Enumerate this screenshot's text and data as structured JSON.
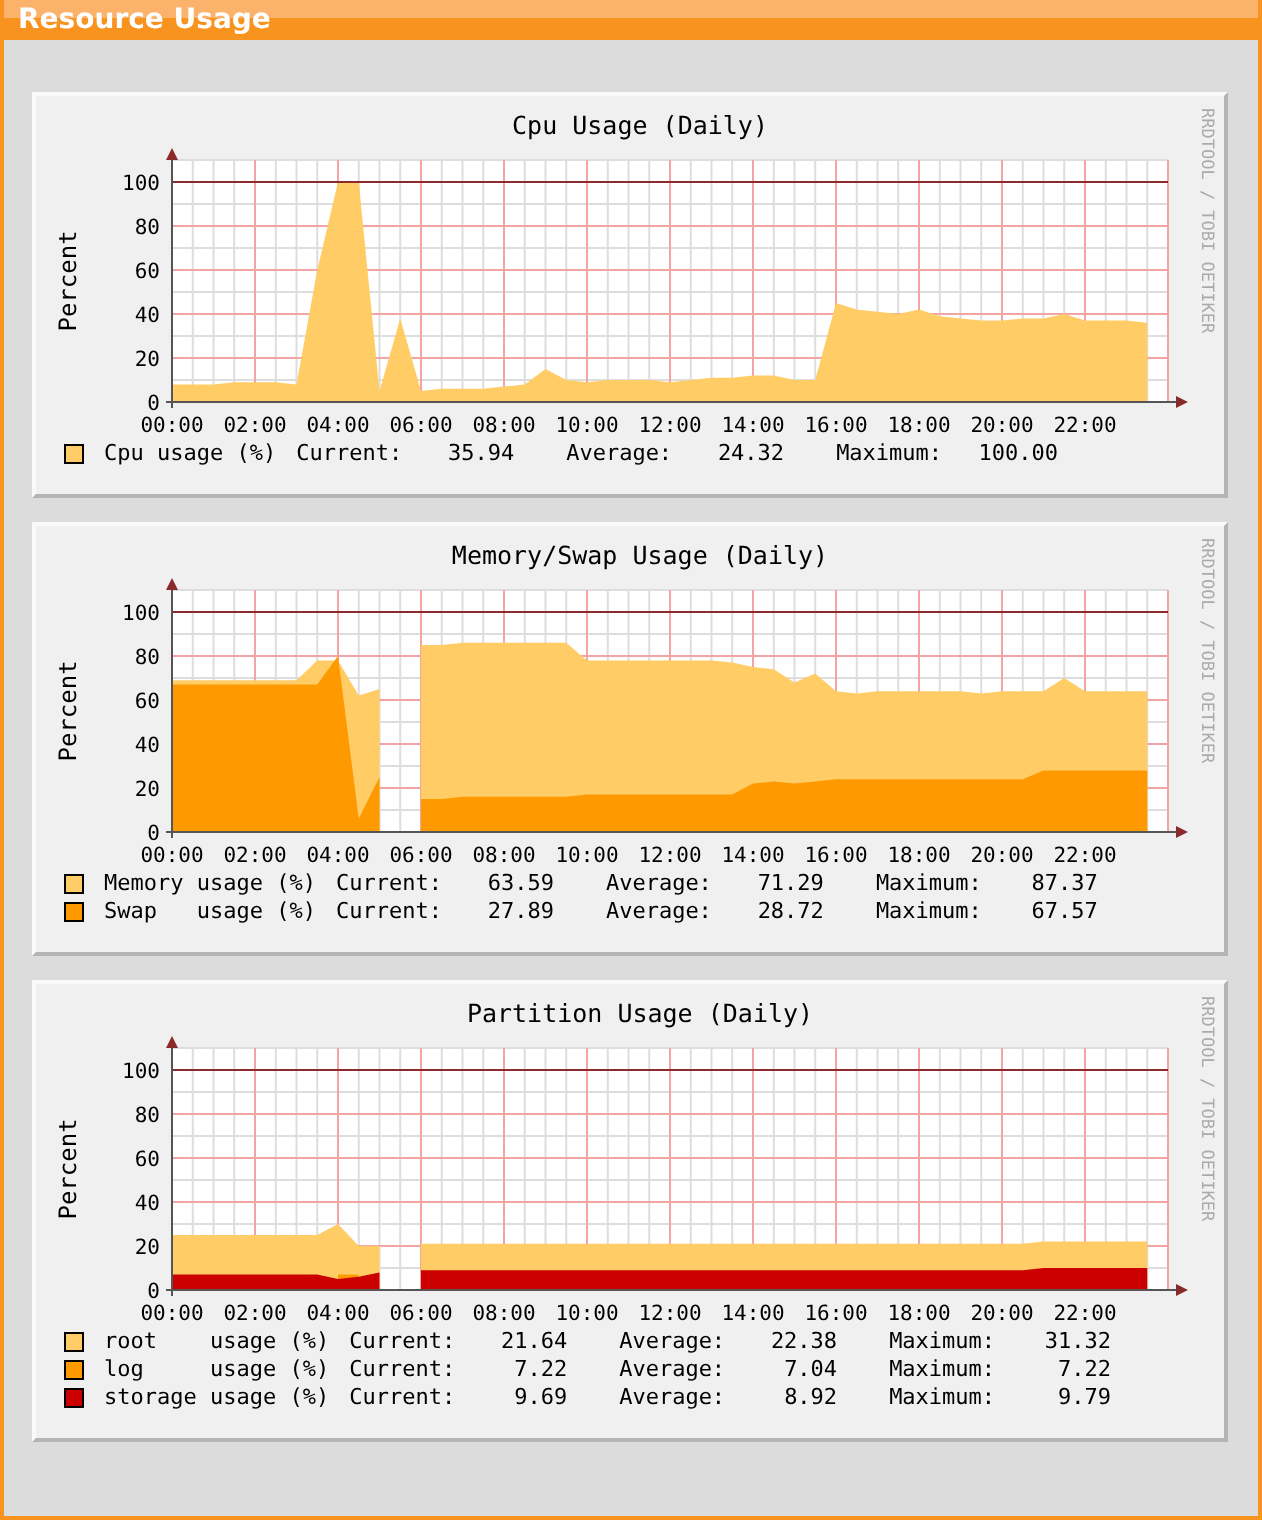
{
  "header": {
    "title": "Resource Usage"
  },
  "graphs": [
    {
      "credit": "RRDTOOL / TOBI OETIKER",
      "chart_data": {
        "type": "area",
        "title": "Cpu Usage (Daily)",
        "ylabel": "Percent",
        "grid": true,
        "x": [
          0,
          0.5,
          1,
          1.5,
          2,
          2.5,
          3,
          3.5,
          4,
          4.5,
          5,
          5.5,
          6,
          6.5,
          7,
          7.5,
          8,
          8.5,
          9,
          9.5,
          10,
          10.5,
          11,
          11.5,
          12,
          12.5,
          13,
          13.5,
          14,
          14.5,
          15,
          15.5,
          16,
          16.5,
          17,
          17.5,
          18,
          18.5,
          19,
          19.5,
          20,
          20.5,
          21,
          21.5,
          22,
          22.5,
          23,
          23.5
        ],
        "xlim": [
          0,
          24
        ],
        "ylim": [
          0,
          110
        ],
        "xticks": [
          {
            "value": 0,
            "label": "00:00"
          },
          {
            "value": 2,
            "label": "02:00"
          },
          {
            "value": 4,
            "label": "04:00"
          },
          {
            "value": 6,
            "label": "06:00"
          },
          {
            "value": 8,
            "label": "08:00"
          },
          {
            "value": 10,
            "label": "10:00"
          },
          {
            "value": 12,
            "label": "12:00"
          },
          {
            "value": 14,
            "label": "14:00"
          },
          {
            "value": 16,
            "label": "16:00"
          },
          {
            "value": 18,
            "label": "18:00"
          },
          {
            "value": 20,
            "label": "20:00"
          },
          {
            "value": 22,
            "label": "22:00"
          }
        ],
        "yticks": [
          0,
          20,
          40,
          60,
          80,
          100
        ],
        "ref_lines": [
          {
            "axis": "y",
            "value": 100
          }
        ],
        "series": [
          {
            "name": "Cpu usage (%)",
            "color": "#ffcc66",
            "values": [
              8,
              8,
              8,
              9,
              9,
              9,
              8,
              60,
              100,
              100,
              5,
              38,
              5,
              6,
              6,
              6,
              7,
              8,
              15,
              10,
              9,
              10,
              10,
              10,
              9,
              10,
              11,
              11,
              12,
              12,
              10,
              10,
              45,
              42,
              41,
              40,
              42,
              39,
              38,
              37,
              37,
              38,
              38,
              40,
              37,
              37,
              37,
              36
            ]
          }
        ]
      },
      "legend": [
        {
          "current_label": "Current:",
          "current": "35.94",
          "average_label": "Average:",
          "average": "24.32",
          "maximum_label": "Maximum:",
          "maximum": "100.00"
        }
      ]
    },
    {
      "credit": "RRDTOOL / TOBI OETIKER",
      "chart_data": {
        "type": "area",
        "title": "Memory/Swap Usage (Daily)",
        "ylabel": "Percent",
        "grid": true,
        "x": [
          0,
          0.5,
          1,
          1.5,
          2,
          2.5,
          3,
          3.5,
          4,
          4.5,
          5,
          5.5,
          6,
          6.5,
          7,
          7.5,
          8,
          8.5,
          9,
          9.5,
          10,
          10.5,
          11,
          11.5,
          12,
          12.5,
          13,
          13.5,
          14,
          14.5,
          15,
          15.5,
          16,
          16.5,
          17,
          17.5,
          18,
          18.5,
          19,
          19.5,
          20,
          20.5,
          21,
          21.5,
          22,
          22.5,
          23,
          23.5
        ],
        "xlim": [
          0,
          24
        ],
        "ylim": [
          0,
          110
        ],
        "xticks": [
          {
            "value": 0,
            "label": "00:00"
          },
          {
            "value": 2,
            "label": "02:00"
          },
          {
            "value": 4,
            "label": "04:00"
          },
          {
            "value": 6,
            "label": "06:00"
          },
          {
            "value": 8,
            "label": "08:00"
          },
          {
            "value": 10,
            "label": "10:00"
          },
          {
            "value": 12,
            "label": "12:00"
          },
          {
            "value": 14,
            "label": "14:00"
          },
          {
            "value": 16,
            "label": "16:00"
          },
          {
            "value": 18,
            "label": "18:00"
          },
          {
            "value": 20,
            "label": "20:00"
          },
          {
            "value": 22,
            "label": "22:00"
          }
        ],
        "yticks": [
          0,
          20,
          40,
          60,
          80,
          100
        ],
        "ref_lines": [
          {
            "axis": "y",
            "value": 100
          }
        ],
        "series": [
          {
            "name": "Memory usage (%)",
            "color": "#ffcc66",
            "values": [
              69,
              69,
              69,
              69,
              69,
              69,
              69,
              78,
              78,
              62,
              65,
              null,
              85,
              85,
              86,
              86,
              86,
              86,
              86,
              86,
              78,
              78,
              78,
              78,
              78,
              78,
              78,
              77,
              75,
              74,
              68,
              72,
              64,
              63,
              64,
              64,
              64,
              64,
              64,
              63,
              64,
              64,
              64,
              70,
              64,
              64,
              64,
              64
            ]
          },
          {
            "name": "Swap   usage (%)",
            "color": "#ff9900",
            "values": [
              67,
              67,
              67,
              67,
              67,
              67,
              67,
              67,
              80,
              6,
              25,
              null,
              15,
              15,
              16,
              16,
              16,
              16,
              16,
              16,
              17,
              17,
              17,
              17,
              17,
              17,
              17,
              17,
              22,
              23,
              22,
              23,
              24,
              24,
              24,
              24,
              24,
              24,
              24,
              24,
              24,
              24,
              28,
              28,
              28,
              28,
              28,
              28
            ]
          }
        ]
      },
      "legend": [
        {
          "current_label": "Current:",
          "current": "63.59",
          "average_label": "Average:",
          "average": "71.29",
          "maximum_label": "Maximum:",
          "maximum": "87.37"
        },
        {
          "current_label": "Current:",
          "current": "27.89",
          "average_label": "Average:",
          "average": "28.72",
          "maximum_label": "Maximum:",
          "maximum": "67.57"
        }
      ]
    },
    {
      "credit": "RRDTOOL / TOBI OETIKER",
      "chart_data": {
        "type": "area",
        "title": "Partition Usage (Daily)",
        "ylabel": "Percent",
        "grid": true,
        "x": [
          0,
          0.5,
          1,
          1.5,
          2,
          2.5,
          3,
          3.5,
          4,
          4.5,
          5,
          5.5,
          6,
          6.5,
          7,
          7.5,
          8,
          8.5,
          9,
          9.5,
          10,
          10.5,
          11,
          11.5,
          12,
          12.5,
          13,
          13.5,
          14,
          14.5,
          15,
          15.5,
          16,
          16.5,
          17,
          17.5,
          18,
          18.5,
          19,
          19.5,
          20,
          20.5,
          21,
          21.5,
          22,
          22.5,
          23,
          23.5
        ],
        "xlim": [
          0,
          24
        ],
        "ylim": [
          0,
          110
        ],
        "xticks": [
          {
            "value": 0,
            "label": "00:00"
          },
          {
            "value": 2,
            "label": "02:00"
          },
          {
            "value": 4,
            "label": "04:00"
          },
          {
            "value": 6,
            "label": "06:00"
          },
          {
            "value": 8,
            "label": "08:00"
          },
          {
            "value": 10,
            "label": "10:00"
          },
          {
            "value": 12,
            "label": "12:00"
          },
          {
            "value": 14,
            "label": "14:00"
          },
          {
            "value": 16,
            "label": "16:00"
          },
          {
            "value": 18,
            "label": "18:00"
          },
          {
            "value": 20,
            "label": "20:00"
          },
          {
            "value": 22,
            "label": "22:00"
          }
        ],
        "yticks": [
          0,
          20,
          40,
          60,
          80,
          100
        ],
        "ref_lines": [
          {
            "axis": "y",
            "value": 100
          }
        ],
        "series": [
          {
            "name": "root    usage (%)",
            "color": "#ffcc66",
            "values": [
              25,
              25,
              25,
              25,
              25,
              25,
              25,
              25,
              30,
              20,
              20,
              null,
              21,
              21,
              21,
              21,
              21,
              21,
              21,
              21,
              21,
              21,
              21,
              21,
              21,
              21,
              21,
              21,
              21,
              21,
              21,
              21,
              21,
              21,
              21,
              21,
              21,
              21,
              21,
              21,
              21,
              21,
              22,
              22,
              22,
              22,
              22,
              22
            ]
          },
          {
            "name": "log     usage (%)",
            "color": "#ff9900",
            "values": [
              null,
              null,
              null,
              null,
              null,
              null,
              null,
              null,
              7,
              7,
              null,
              null,
              null,
              null,
              null,
              null,
              null,
              null,
              null,
              null,
              null,
              null,
              null,
              null,
              null,
              null,
              null,
              null,
              null,
              null,
              null,
              null,
              null,
              null,
              null,
              null,
              null,
              null,
              null,
              null,
              null,
              null,
              null,
              null,
              null,
              null,
              null,
              null
            ]
          },
          {
            "name": "storage usage (%)",
            "color": "#cc0000",
            "values": [
              7,
              7,
              7,
              7,
              7,
              7,
              7,
              7,
              5,
              6,
              8,
              null,
              9,
              9,
              9,
              9,
              9,
              9,
              9,
              9,
              9,
              9,
              9,
              9,
              9,
              9,
              9,
              9,
              9,
              9,
              9,
              9,
              9,
              9,
              9,
              9,
              9,
              9,
              9,
              9,
              9,
              9,
              10,
              10,
              10,
              10,
              10,
              10
            ]
          }
        ]
      },
      "legend": [
        {
          "current_label": "Current:",
          "current": "21.64",
          "average_label": "Average:",
          "average": "22.38",
          "maximum_label": "Maximum:",
          "maximum": "31.32"
        },
        {
          "current_label": "Current:",
          "current": "7.22",
          "average_label": "Average:",
          "average": "7.04",
          "maximum_label": "Maximum:",
          "maximum": "7.22"
        },
        {
          "current_label": "Current:",
          "current": "9.69",
          "average_label": "Average:",
          "average": "8.92",
          "maximum_label": "Maximum:",
          "maximum": "9.79"
        }
      ]
    }
  ]
}
